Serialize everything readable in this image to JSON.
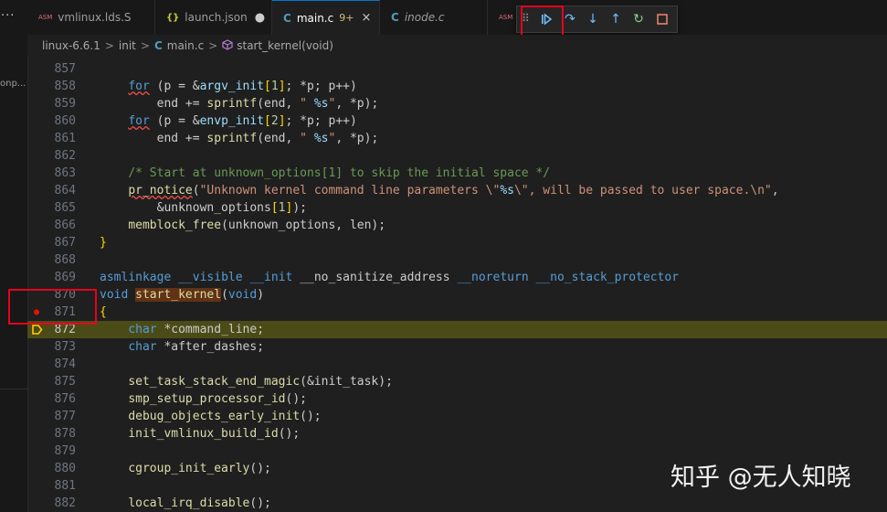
{
  "sidebar": {
    "more": "···",
    "truncated_label": "onp..."
  },
  "tabs": [
    {
      "icon": "ASM",
      "label": "vmlinux.lds.S"
    },
    {
      "icon": "{}",
      "label": "launch.json",
      "dirty": "●"
    },
    {
      "icon": "C",
      "label": "main.c",
      "badge": "9+",
      "close": "×"
    },
    {
      "icon": "C",
      "label": "inode.c"
    },
    {
      "icon": "ASM"
    }
  ],
  "debug_toolbar": {
    "grip": "⠿",
    "continue": "▷",
    "step_over": "↷",
    "step_into": "↓",
    "step_out": "↑",
    "restart": "↻",
    "stop": "□"
  },
  "breadcrumb": [
    "linux-6.6.1",
    "init",
    "main.c",
    "start_kernel(void)"
  ],
  "breadcrumb_sep": ">",
  "editor": {
    "breakpoint_line": "871",
    "current_line": "872",
    "lines": [
      {
        "n": "857",
        "parts": []
      },
      {
        "n": "858",
        "parts": [
          [
            "    ",
            ""
          ],
          [
            "for",
            "kw squig"
          ],
          [
            " (p = &",
            ""
          ],
          [
            "argv_init",
            "var"
          ],
          [
            "[",
            "br"
          ],
          [
            "1",
            "num"
          ],
          [
            "]",
            "br"
          ],
          [
            "; *p; p++)",
            ""
          ]
        ]
      },
      {
        "n": "859",
        "parts": [
          [
            "        end += ",
            ""
          ],
          [
            "sprintf",
            "fn"
          ],
          [
            "(end, ",
            ""
          ],
          [
            "\" ",
            "str"
          ],
          [
            "%s",
            "fmt"
          ],
          [
            "\"",
            "str"
          ],
          [
            ", *p);",
            ""
          ]
        ]
      },
      {
        "n": "860",
        "parts": [
          [
            "    ",
            ""
          ],
          [
            "for",
            "kw squig"
          ],
          [
            " (p = &",
            ""
          ],
          [
            "envp_init",
            "var"
          ],
          [
            "[",
            "br"
          ],
          [
            "2",
            "num"
          ],
          [
            "]",
            "br"
          ],
          [
            "; *p; p++)",
            ""
          ]
        ]
      },
      {
        "n": "861",
        "parts": [
          [
            "        end += ",
            ""
          ],
          [
            "sprintf",
            "fn"
          ],
          [
            "(end, ",
            ""
          ],
          [
            "\" ",
            "str"
          ],
          [
            "%s",
            "fmt"
          ],
          [
            "\"",
            "str"
          ],
          [
            ", *p);",
            ""
          ]
        ]
      },
      {
        "n": "862",
        "parts": []
      },
      {
        "n": "863",
        "parts": [
          [
            "    ",
            ""
          ],
          [
            "/* Start at unknown_options[1] to skip the initial space */",
            "com"
          ]
        ]
      },
      {
        "n": "864",
        "parts": [
          [
            "    ",
            ""
          ],
          [
            "pr_notice",
            "fn squig"
          ],
          [
            "(",
            ""
          ],
          [
            "\"Unknown kernel command line parameters \\\"",
            "str"
          ],
          [
            "%s",
            "fmt"
          ],
          [
            "\\\", will be passed to user space.\\n\"",
            "str"
          ],
          [
            ",",
            ""
          ]
        ]
      },
      {
        "n": "865",
        "parts": [
          [
            "        &unknown_options",
            ""
          ],
          [
            "[",
            "br"
          ],
          [
            "1",
            "num"
          ],
          [
            "]",
            "br"
          ],
          [
            ");",
            ""
          ]
        ]
      },
      {
        "n": "866",
        "parts": [
          [
            "    ",
            ""
          ],
          [
            "memblock_free",
            "fn"
          ],
          [
            "(unknown_options, len);",
            ""
          ]
        ]
      },
      {
        "n": "867",
        "parts": [
          [
            "}",
            "br"
          ]
        ]
      },
      {
        "n": "868",
        "parts": []
      },
      {
        "n": "869",
        "parts": [
          [
            "asmlinkage",
            "kw"
          ],
          [
            " ",
            ""
          ],
          [
            "__visible",
            "kw"
          ],
          [
            " ",
            ""
          ],
          [
            "__init",
            "kw"
          ],
          [
            " __no_sanitize_address ",
            ""
          ],
          [
            "__noreturn",
            "kw"
          ],
          [
            " ",
            ""
          ],
          [
            "__no_stack_protector",
            "kw"
          ]
        ]
      },
      {
        "n": "870",
        "parts": [
          [
            "void",
            "kw"
          ],
          [
            " ",
            ""
          ],
          [
            "start_kernel",
            "fn hl"
          ],
          [
            "(",
            ""
          ],
          [
            "void",
            "kw"
          ],
          [
            ")",
            ""
          ]
        ]
      },
      {
        "n": "871",
        "parts": [
          [
            "{",
            "br"
          ]
        ]
      },
      {
        "n": "872",
        "parts": [
          [
            "    ",
            ""
          ],
          [
            "char",
            "kw"
          ],
          [
            " *command_line;",
            ""
          ]
        ]
      },
      {
        "n": "873",
        "parts": [
          [
            "    ",
            ""
          ],
          [
            "char",
            "kw"
          ],
          [
            " *after_dashes;",
            ""
          ]
        ]
      },
      {
        "n": "874",
        "parts": []
      },
      {
        "n": "875",
        "parts": [
          [
            "    ",
            ""
          ],
          [
            "set_task_stack_end_magic",
            "fn"
          ],
          [
            "(&init_task);",
            ""
          ]
        ]
      },
      {
        "n": "876",
        "parts": [
          [
            "    ",
            ""
          ],
          [
            "smp_setup_processor_id",
            "fn"
          ],
          [
            "();",
            ""
          ]
        ]
      },
      {
        "n": "877",
        "parts": [
          [
            "    ",
            ""
          ],
          [
            "debug_objects_early_init",
            "fn"
          ],
          [
            "();",
            ""
          ]
        ]
      },
      {
        "n": "878",
        "parts": [
          [
            "    ",
            ""
          ],
          [
            "init_vmlinux_build_id",
            "fn"
          ],
          [
            "();",
            ""
          ]
        ]
      },
      {
        "n": "879",
        "parts": []
      },
      {
        "n": "880",
        "parts": [
          [
            "    ",
            ""
          ],
          [
            "cgroup_init_early",
            "fn"
          ],
          [
            "();",
            ""
          ]
        ]
      },
      {
        "n": "881",
        "parts": []
      },
      {
        "n": "882",
        "parts": [
          [
            "    ",
            ""
          ],
          [
            "local_irq_disable",
            "fn"
          ],
          [
            "();",
            ""
          ]
        ]
      }
    ]
  },
  "watermark": "知乎 @无人知晓",
  "colors": {
    "accent": "#0078d4",
    "highlight_box": "#e8001c",
    "current_line_bg": "#4b4b18",
    "breakpoint": "#e51400"
  }
}
